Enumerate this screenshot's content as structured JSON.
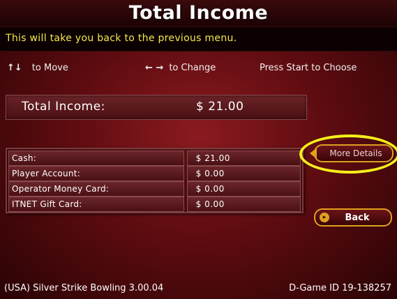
{
  "header": {
    "title": "Total Income"
  },
  "info": {
    "message": "This will take you back to the previous menu."
  },
  "nav_help": {
    "move_arrows": "↑↓",
    "move_text": "to Move",
    "change_arrows": "← →",
    "change_text": "to Change",
    "start_text": "Press Start to Choose"
  },
  "total": {
    "label": "Total Income:",
    "value": "$ 21.00"
  },
  "income_rows": [
    {
      "label": "Cash:",
      "value": "$ 21.00"
    },
    {
      "label": "Player Account:",
      "value": "$ 0.00"
    },
    {
      "label": "Operator Money Card:",
      "value": "$ 0.00"
    },
    {
      "label": "ITNET Gift Card:",
      "value": "$ 0.00"
    }
  ],
  "buttons": {
    "more_details": "More Details",
    "back": "Back"
  },
  "footer": {
    "left": "(USA) Silver Strike Bowling 3.00.04",
    "right": "D-Game ID 19-138257"
  },
  "colors": {
    "accent": "#e0a020",
    "highlight": "#f4ee1a",
    "info_text": "#f6e84a",
    "background": "#5e0c10"
  },
  "icons": {
    "more_details": "left-triangle-icon",
    "back": "chevron-right-icon"
  }
}
